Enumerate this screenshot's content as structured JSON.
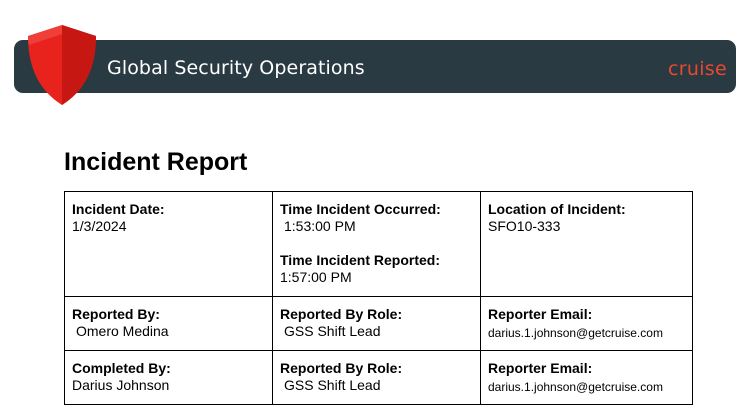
{
  "header": {
    "title": "Global Security Operations",
    "brand": "cruise",
    "brand_color": "#e8492e",
    "banner_color": "#2a3a42",
    "logo_icon": "red-shield-icon"
  },
  "report": {
    "title": "Incident Report",
    "rows": [
      [
        {
          "label": "Incident Date:",
          "value": "1/3/2024"
        },
        {
          "label": "Time Incident Occurred:",
          "value": "1:53:00 PM",
          "label2": "Time Incident Reported:",
          "value2": "1:57:00 PM"
        },
        {
          "label": "Location of Incident:",
          "value": "SFO10-333"
        }
      ],
      [
        {
          "label": "Reported By:",
          "value": "Omero Medina"
        },
        {
          "label": "Reported By Role:",
          "value": "GSS Shift Lead"
        },
        {
          "label": "Reporter Email:",
          "value": "darius.1.johnson@getcruise.com"
        }
      ],
      [
        {
          "label": "Completed By:",
          "value": "Darius Johnson"
        },
        {
          "label": "Reported By Role:",
          "value": "GSS Shift Lead"
        },
        {
          "label": "Reporter Email:",
          "value": "darius.1.johnson@getcruise.com"
        }
      ]
    ]
  }
}
